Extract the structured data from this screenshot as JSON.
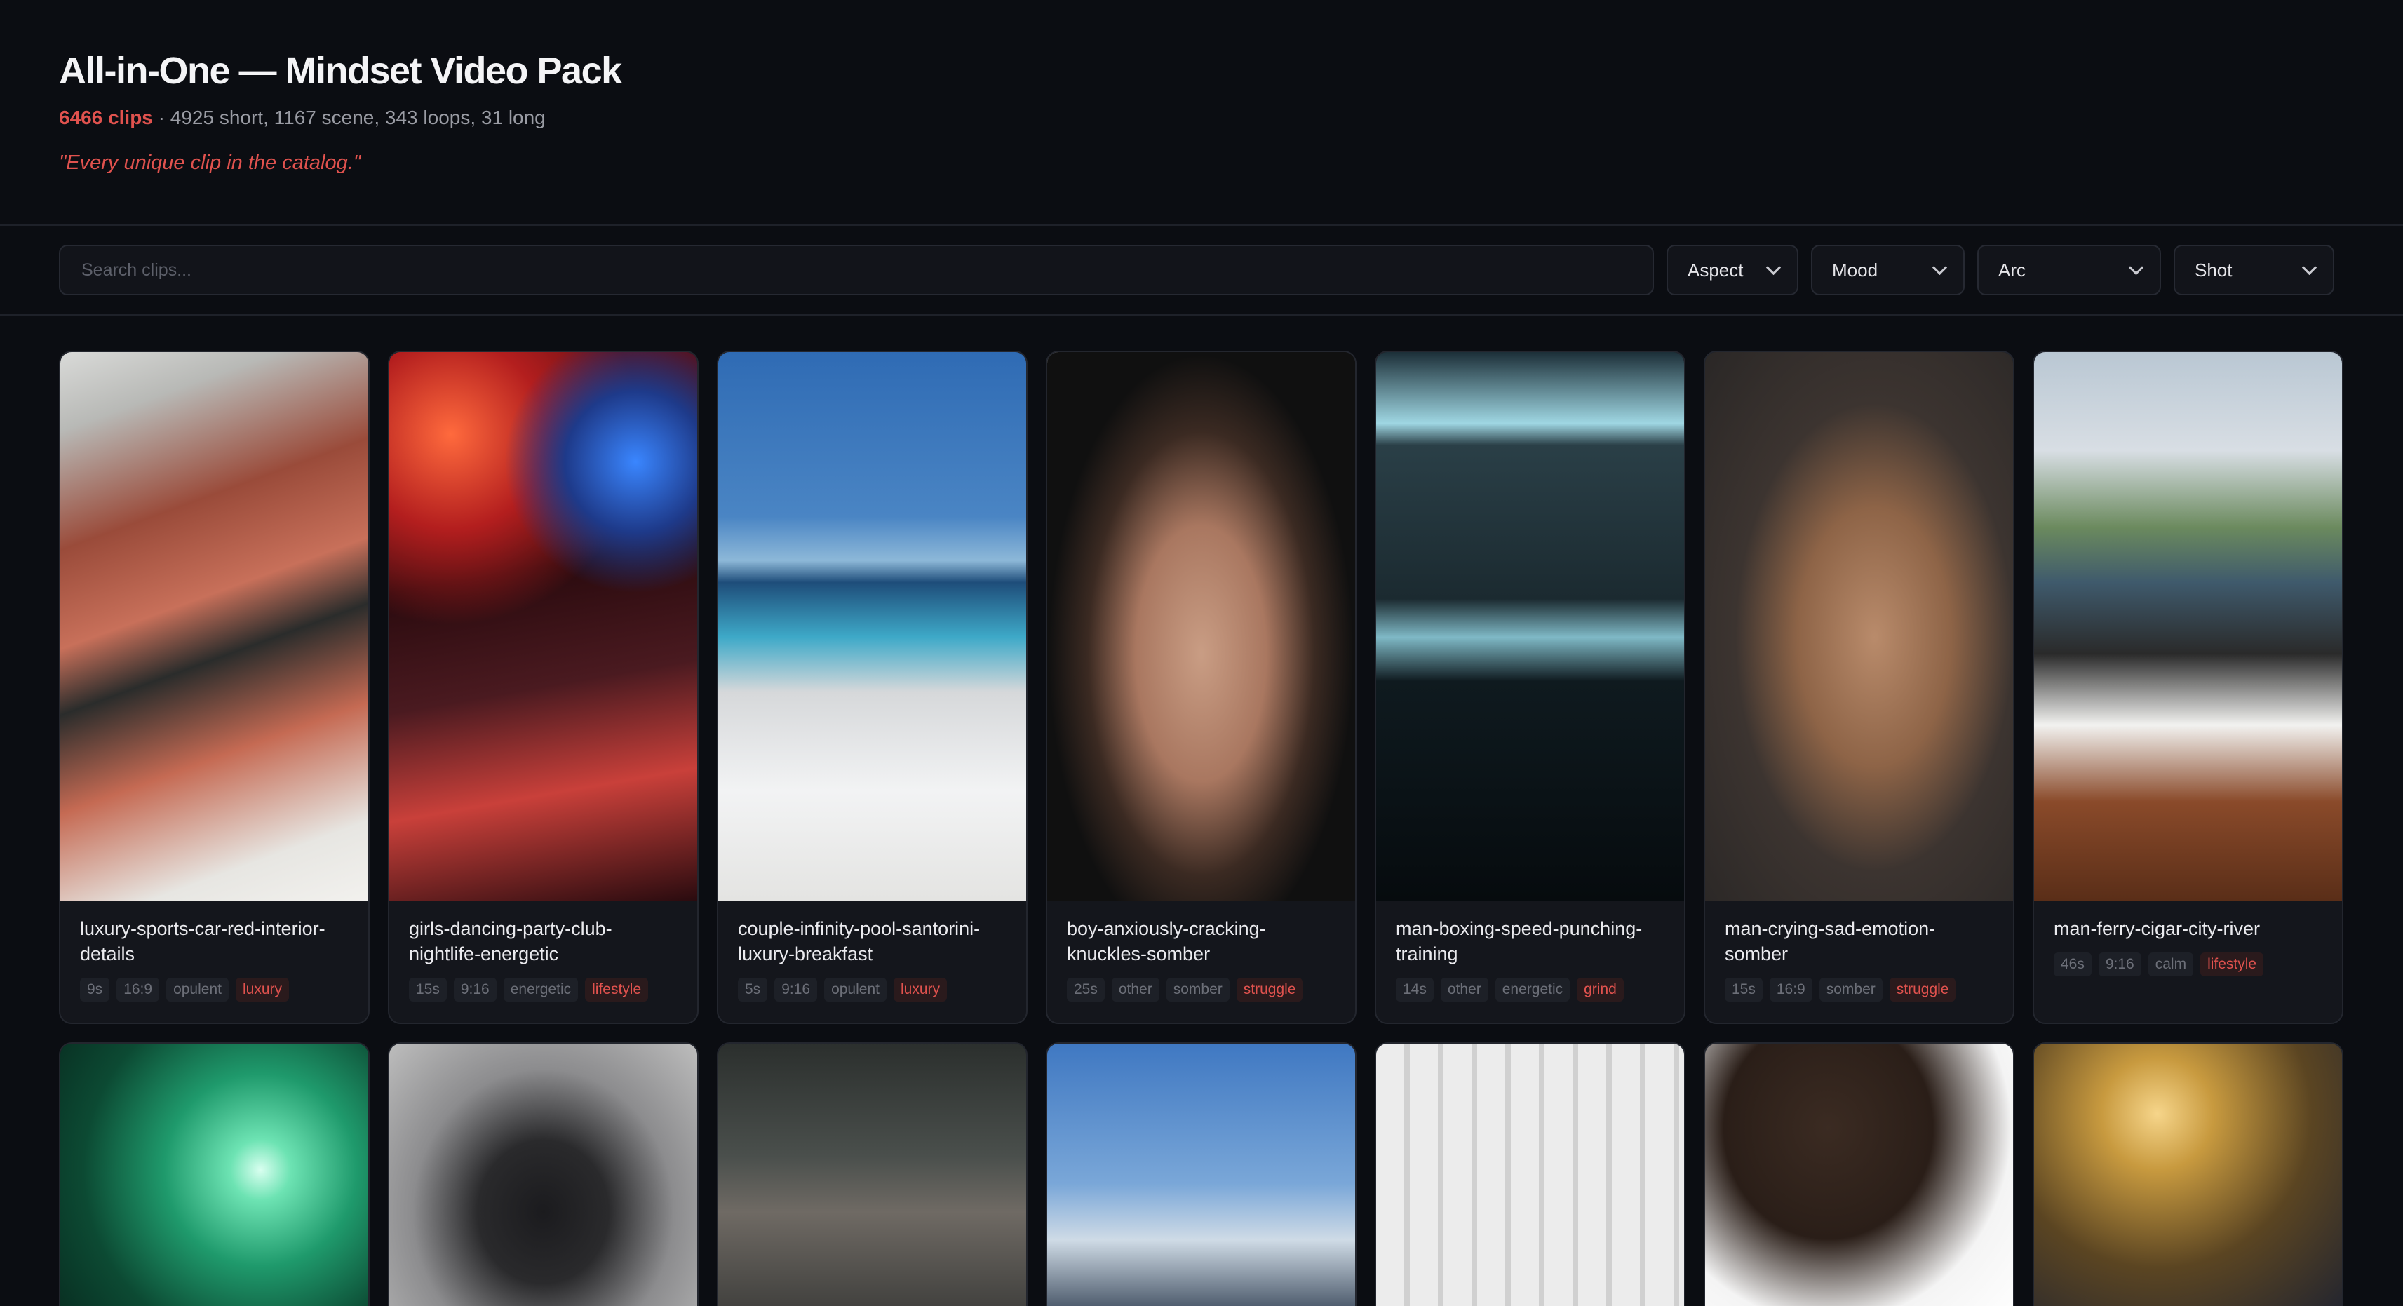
{
  "header": {
    "title": "All-in-One — Mindset Video Pack",
    "clip_count": "6466 clips",
    "breakdown": " · 4925 short, 1167 scene, 343 loops, 31 long",
    "tagline": "\"Every unique clip in the catalog.\""
  },
  "toolbar": {
    "search_placeholder": "Search clips...",
    "filters": {
      "aspect": "Aspect",
      "mood": "Mood",
      "arc": "Arc",
      "shot": "Shot"
    }
  },
  "colors": {
    "accent": "#e0524e",
    "background": "#0b0d12",
    "card": "#14161c"
  },
  "clips": [
    {
      "name": "luxury-sports-car-red-interior-details",
      "duration": "9s",
      "aspect": "16:9",
      "mood": "opulent",
      "arc": "luxury"
    },
    {
      "name": "girls-dancing-party-club-nightlife-energetic",
      "duration": "15s",
      "aspect": "9:16",
      "mood": "energetic",
      "arc": "lifestyle"
    },
    {
      "name": "couple-infinity-pool-santorini-luxury-breakfast",
      "duration": "5s",
      "aspect": "9:16",
      "mood": "opulent",
      "arc": "luxury"
    },
    {
      "name": "boy-anxiously-cracking-knuckles-somber",
      "duration": "25s",
      "aspect": "other",
      "mood": "somber",
      "arc": "struggle"
    },
    {
      "name": "man-boxing-speed-punching-training",
      "duration": "14s",
      "aspect": "other",
      "mood": "energetic",
      "arc": "grind"
    },
    {
      "name": "man-crying-sad-emotion-somber",
      "duration": "15s",
      "aspect": "16:9",
      "mood": "somber",
      "arc": "struggle"
    },
    {
      "name": "man-ferry-cigar-city-river",
      "duration": "46s",
      "aspect": "9:16",
      "mood": "calm",
      "arc": "lifestyle"
    }
  ]
}
